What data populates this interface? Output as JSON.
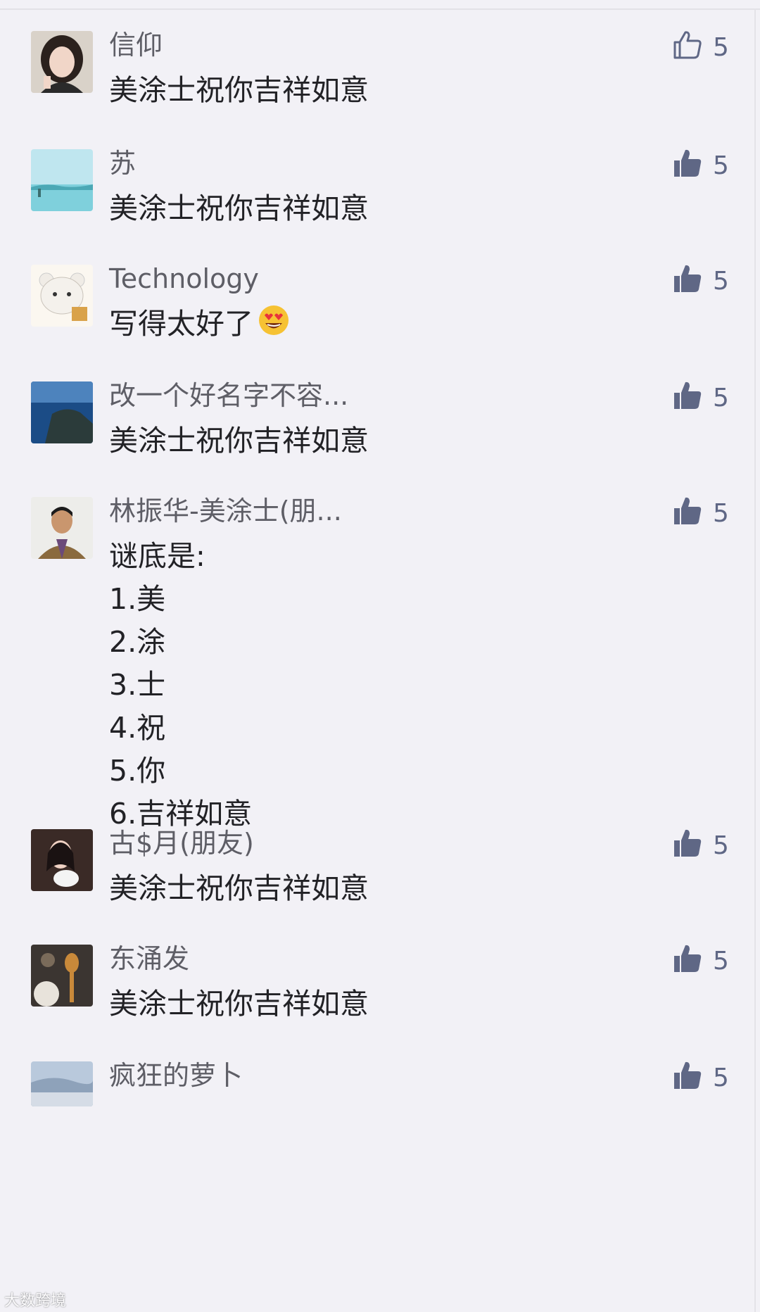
{
  "comments": [
    {
      "name": "信仰",
      "lines": [
        "美涂士祝你吉祥如意"
      ],
      "likes": "5",
      "liked_by_me": false,
      "avatar": "avatar-woman-portrait"
    },
    {
      "name": "苏",
      "lines": [
        "美涂士祝你吉祥如意"
      ],
      "likes": "5",
      "liked_by_me": true,
      "avatar": "avatar-sea-landscape"
    },
    {
      "name": "Technology",
      "lines": [
        "写得太好了"
      ],
      "likes": "5",
      "liked_by_me": true,
      "avatar": "avatar-cartoon-bear",
      "emoji": "heart-eyes-emoji"
    },
    {
      "name": "改一个好名字不容...",
      "lines": [
        "美涂士祝你吉祥如意"
      ],
      "likes": "5",
      "liked_by_me": true,
      "avatar": "avatar-coast-rock"
    },
    {
      "name": "林振华-美涂士(朋...",
      "lines": [
        "谜底是:",
        "1.美",
        "2.涂",
        "3.士",
        "4.祝",
        "5.你",
        "6.吉祥如意"
      ],
      "likes": "5",
      "liked_by_me": true,
      "avatar": "avatar-man-portrait"
    },
    {
      "name": "古$月(朋友)",
      "lines": [
        "美涂士祝你吉祥如意"
      ],
      "likes": "5",
      "liked_by_me": true,
      "avatar": "avatar-woman-with-pet"
    },
    {
      "name": "东涌发",
      "lines": [
        "美涂士祝你吉祥如意"
      ],
      "likes": "5",
      "liked_by_me": true,
      "avatar": "avatar-food-dishes"
    },
    {
      "name": "疯狂的萝卜",
      "lines": [],
      "likes": "5",
      "liked_by_me": true,
      "avatar": "avatar-sky-landscape"
    }
  ],
  "colors": {
    "like_blue": "#5f6785",
    "name_gray": "#5e5e66",
    "text_dark": "#222226",
    "background": "#f2f1f6"
  },
  "icons": {
    "like": "thumbs-up-icon"
  },
  "watermark": "大数跨境"
}
